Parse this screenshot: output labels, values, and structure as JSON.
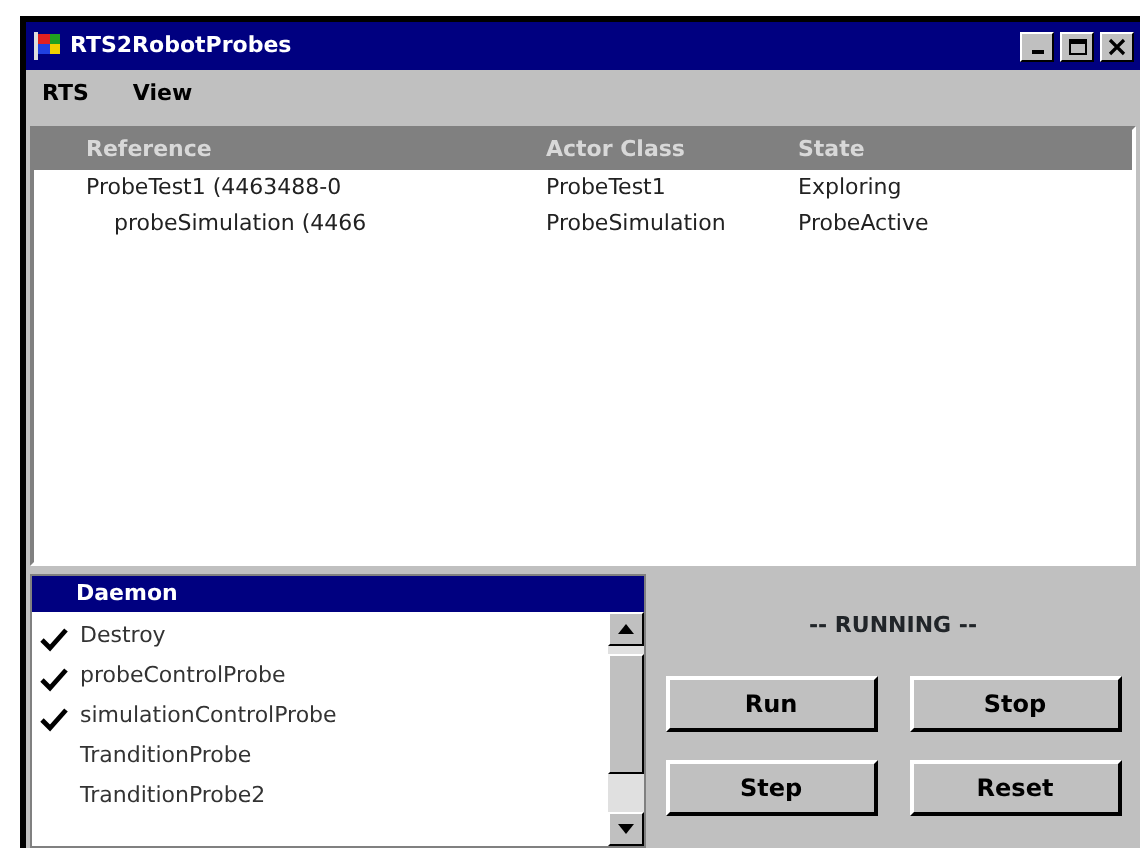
{
  "window": {
    "title": "RTS2RobotProbes"
  },
  "menu": [
    "RTS",
    "View"
  ],
  "table": {
    "columns": [
      "Reference",
      "Actor Class",
      "State"
    ],
    "rows": [
      {
        "cells": [
          "ProbeTest1 (4463488-0",
          "ProbeTest1",
          "Exploring"
        ],
        "children": [
          {
            "cells": [
              "probeSimulation (4466",
              "ProbeSimulation",
              "ProbeActive"
            ]
          }
        ]
      }
    ]
  },
  "daemon": {
    "title": "Daemon",
    "items": [
      {
        "label": "Destroy",
        "checked": true
      },
      {
        "label": "probeControlProbe",
        "checked": true
      },
      {
        "label": "simulationControlProbe",
        "checked": true
      },
      {
        "label": "TranditionProbe",
        "checked": false
      },
      {
        "label": "TranditionProbe2",
        "checked": false
      }
    ]
  },
  "status": "-- RUNNING --",
  "buttons": [
    "Run",
    "Stop",
    "Step",
    "Reset"
  ]
}
